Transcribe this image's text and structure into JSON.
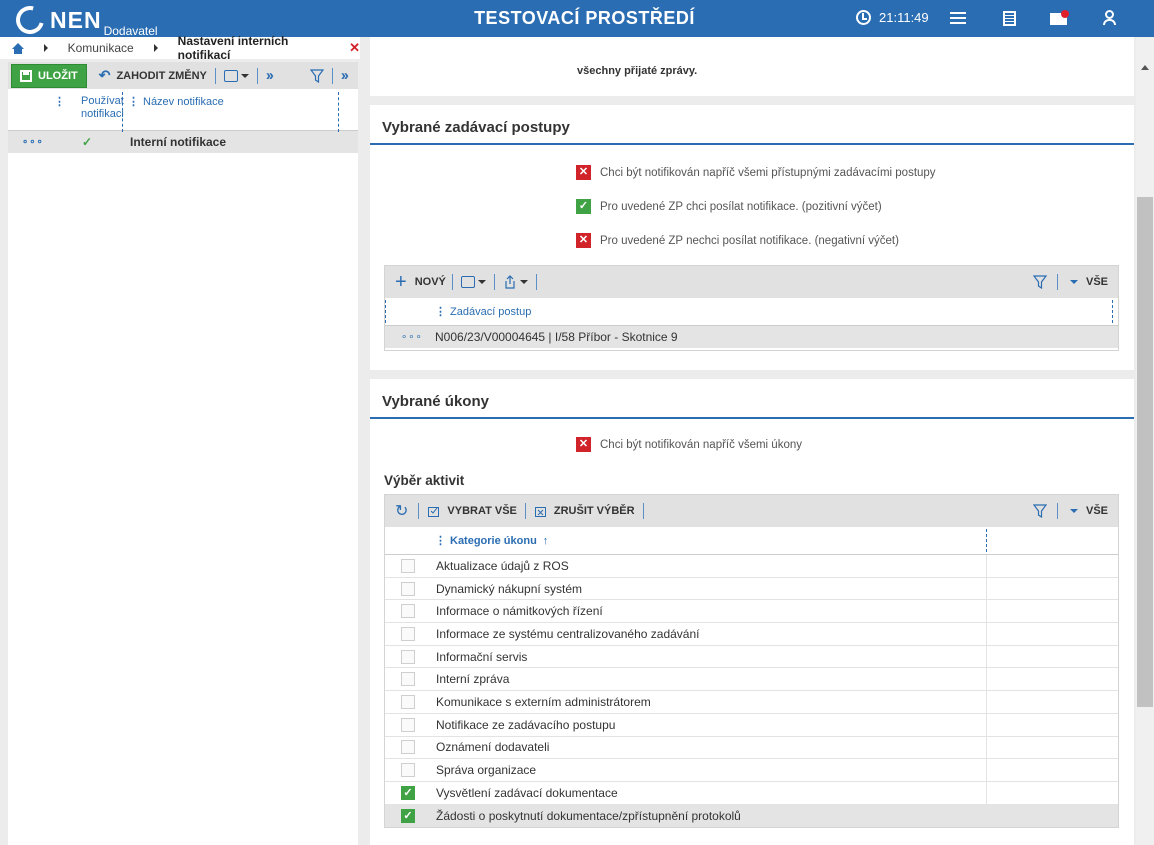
{
  "header": {
    "logo_text": "NEN",
    "logo_sub": "Dodavatel",
    "env_title": "TESTOVACÍ PROSTŘEDÍ",
    "time": "21:11:49",
    "icons": [
      "clock-icon",
      "menu-icon",
      "calculator-icon",
      "mail-icon",
      "user-icon"
    ]
  },
  "breadcrumb": {
    "items": [
      "Komunikace",
      "Nastavení interních notifikací"
    ],
    "close": "✕"
  },
  "left": {
    "toolbar": {
      "save_label": "ULOŽIT",
      "discard_label": "ZAHODIT ZMĚNY"
    },
    "columns": [
      "Používat notifikaci",
      "Název notifikace"
    ],
    "rows": [
      {
        "dots": "∘∘∘",
        "enabled": "✓",
        "name": "Interní notifikace"
      }
    ]
  },
  "top_card": {
    "line2": "všechny přijaté zprávy."
  },
  "zp_card": {
    "title": "Vybrané zadávací postupy",
    "options": [
      {
        "state": "✕",
        "label": "Chci být notifikován napříč všemi přístupnými zadávacími postupy"
      },
      {
        "state": "✓",
        "label": "Pro uvedené ZP chci posílat notifikace. (pozitivní výčet)"
      },
      {
        "state": "✕",
        "label": "Pro uvedené ZP nechci posílat notifikace. (negativní výčet)"
      }
    ],
    "toolbar": {
      "new_label": "NOVÝ",
      "all_label": "VŠE"
    },
    "column": "Zadávací postup",
    "rows": [
      {
        "dots": "∘∘∘",
        "value": "N006/23/V00004645 | I/58 Příbor - Skotnice 9"
      }
    ]
  },
  "uk_card": {
    "title": "Vybrané úkony",
    "option": {
      "state": "✕",
      "label": "Chci být notifikován napříč všemi úkony"
    },
    "section_label": "Výběr aktivit",
    "toolbar": {
      "select_all_label": "VYBRAT VŠE",
      "clear_label": "ZRUŠIT VÝBĚR",
      "all_label": "VŠE"
    },
    "column": "Kategorie úkonu",
    "sort_icon": "↑",
    "rows": [
      {
        "checked": false,
        "label": "Aktualizace údajů z ROS"
      },
      {
        "checked": false,
        "label": "Dynamický nákupní systém"
      },
      {
        "checked": false,
        "label": "Informace o námitkových řízení"
      },
      {
        "checked": false,
        "label": "Informace ze systému centralizovaného zadávání"
      },
      {
        "checked": false,
        "label": "Informační servis"
      },
      {
        "checked": false,
        "label": "Interní zpráva"
      },
      {
        "checked": false,
        "label": "Komunikace s externím administrátorem"
      },
      {
        "checked": false,
        "label": "Notifikace ze zadávacího postupu"
      },
      {
        "checked": false,
        "label": "Oznámení dodavateli"
      },
      {
        "checked": false,
        "label": "Správa organizace"
      },
      {
        "checked": true,
        "label": "Vysvětlení zadávací dokumentace"
      },
      {
        "checked": true,
        "label": "Žádosti o poskytnutí dokumentace/zpřístupnění protokolů"
      }
    ]
  },
  "colors": {
    "brand": "#2a6db2",
    "green": "#3fa244",
    "red": "#d0232a"
  }
}
